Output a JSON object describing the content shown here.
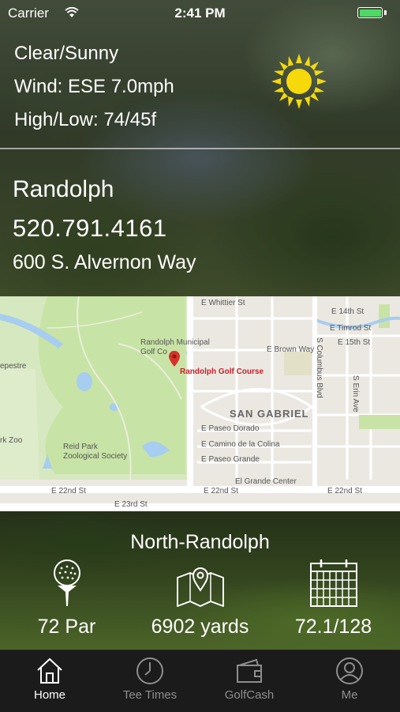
{
  "status_bar": {
    "carrier": "Carrier",
    "time": "2:41 PM",
    "battery_level": 1.0
  },
  "weather": {
    "condition": "Clear/Sunny",
    "wind": "Wind: ESE 7.0mph",
    "high_low": "High/Low: 74/45f",
    "icon": "sun-icon",
    "icon_color": "#f5d90a"
  },
  "course": {
    "name": "Randolph",
    "phone": "520.791.4161",
    "address": "600 S. Alvernon Way"
  },
  "map": {
    "marker_label": "Randolph Golf Course",
    "marker_color": "#d8312b",
    "labels": {
      "randolph_municipal_1": "Randolph Municipal",
      "randolph_municipal_2": "Golf Co",
      "san_gabriel": "SAN GABRIEL",
      "reid_park_1": "Reid Park",
      "reid_park_2": "Zoological Society",
      "el_grande": "El Grande Center",
      "e_whittier": "E Whittier St",
      "e_14th": "E 14th St",
      "e_timrod": "E Timrod St",
      "e_15th": "E 15th St",
      "e_brown": "E Brown Way",
      "s_columbus": "S Columbus Blvd",
      "s_erin": "S Erin Ave",
      "e_paseo_dorado": "E Paseo Dorado",
      "e_camino": "E Camino de la Colina",
      "e_paseo_grande": "E Paseo Grande",
      "e_22nd_left": "E 22nd St",
      "e_22nd_mid": "E 22nd St",
      "e_22nd_right": "E 22nd St",
      "e_23rd": "E 23rd St",
      "epestre": "epestre",
      "rk_zoo": "rk Zoo"
    }
  },
  "details": {
    "layout_name": "North-Randolph",
    "par": "72 Par",
    "yards": "6902 yards",
    "rating": "72.1/128"
  },
  "tabs": [
    {
      "label": "Home",
      "icon": "home-icon",
      "active": true
    },
    {
      "label": "Tee Times",
      "icon": "clock-icon",
      "active": false
    },
    {
      "label": "GolfCash",
      "icon": "wallet-icon",
      "active": false
    },
    {
      "label": "Me",
      "icon": "user-icon",
      "active": false
    }
  ]
}
